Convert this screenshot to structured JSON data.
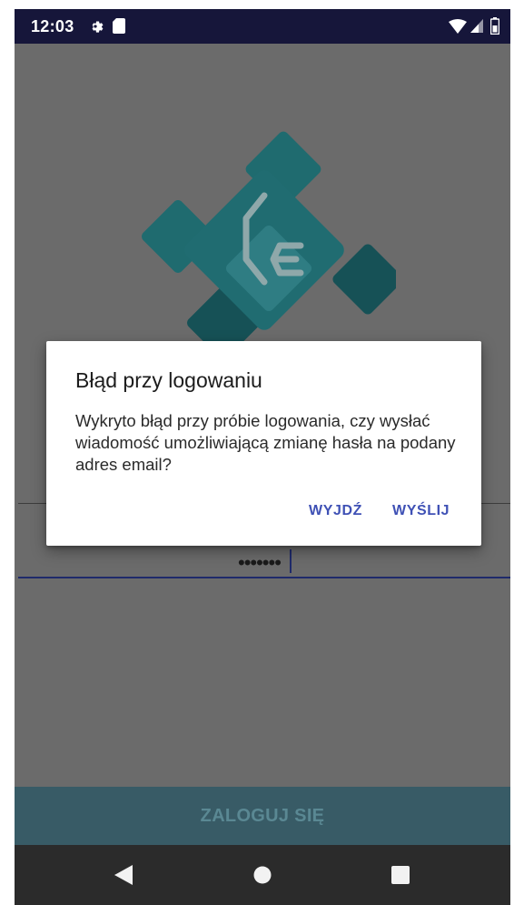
{
  "status_bar": {
    "time": "12:03",
    "icons": [
      "gear-icon",
      "sd-card-icon",
      "wifi-icon",
      "signal-icon",
      "battery-icon"
    ]
  },
  "logo": {
    "icon": "ce-logo",
    "colors": [
      "#196b70",
      "#0f4f55",
      "#2a8088"
    ]
  },
  "form": {
    "password_value": "•••••••"
  },
  "login_button": {
    "label": "ZALOGUJ SIĘ"
  },
  "dialog": {
    "title": "Błąd przy logowaniu",
    "message": "Wykryto błąd przy próbie logowania, czy wysłać wiadomość umożliwiającą zmianę hasła na podany adres email?",
    "exit_label": "WYJDŹ",
    "send_label": "WYŚLIJ"
  },
  "nav_bar": {
    "icons": [
      "back-icon",
      "home-icon",
      "recents-icon"
    ]
  },
  "colors": {
    "accent": "#3f51b5",
    "status_bar": "#16163a",
    "scrim_background": "#6b6b6b",
    "login_button": "#385b66"
  }
}
